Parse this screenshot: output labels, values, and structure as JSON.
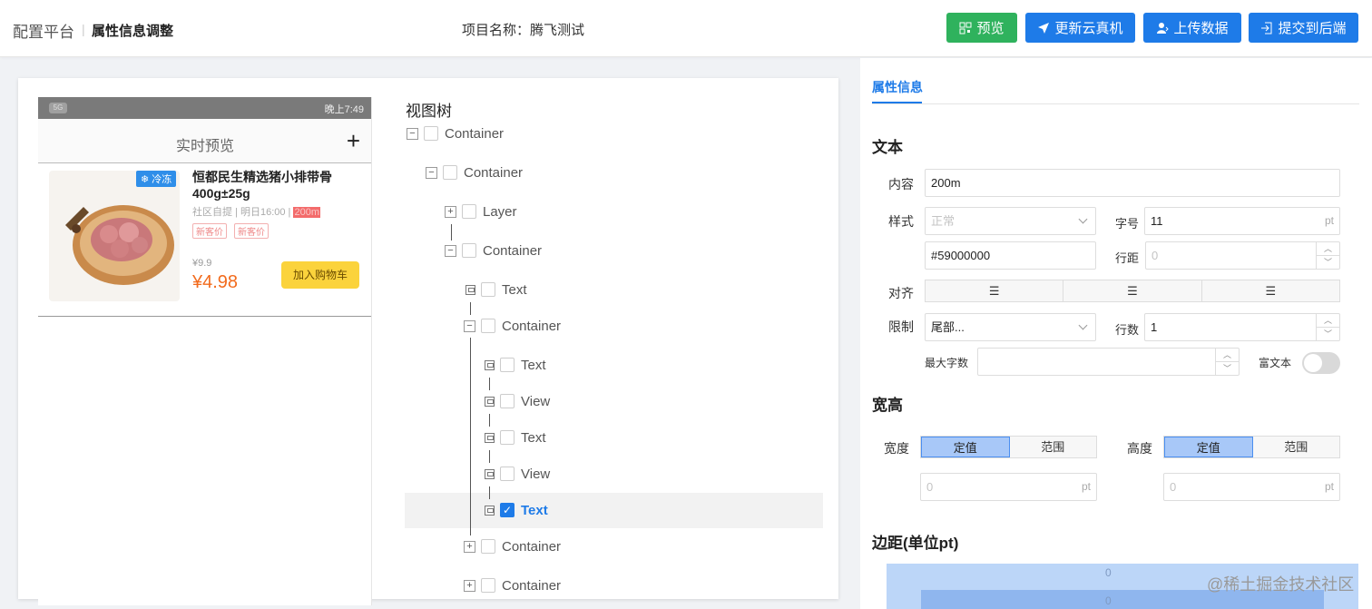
{
  "header": {
    "brand": "配置平台",
    "separator": "|",
    "page_title": "属性信息调整",
    "project_label": "项目名称：腾飞测试",
    "buttons": [
      {
        "label": "预览",
        "icon": "qrcode-icon"
      },
      {
        "label": "更新云真机",
        "icon": "send-icon"
      },
      {
        "label": "上传数据",
        "icon": "user-upload-icon"
      },
      {
        "label": "提交到后端",
        "icon": "login-icon"
      }
    ]
  },
  "phone": {
    "status_left": "5G",
    "status_right": "晚上7:49",
    "nav_title": "实时预览",
    "nav_add": "+",
    "goods": {
      "tag": "❄ 冷冻",
      "name": "恒都民生精选猪小排带骨400g±25g",
      "meta_pre": "社区自提 | 明日16:00 | ",
      "meta_hl": "200m",
      "badges": [
        "新客价",
        "新客价"
      ],
      "old_price": "¥9.9",
      "price": "¥4.98",
      "cart": "加入购物车"
    }
  },
  "tree": {
    "title": "视图树",
    "nodes": [
      "Container",
      "Container",
      "Layer",
      "Container",
      "Text",
      "Container",
      "Text",
      "View",
      "Text",
      "View",
      "Text",
      "Container",
      "Container"
    ]
  },
  "props": {
    "tab": "属性信息",
    "text_section": "文本",
    "content_label": "内容",
    "content_value": "200m",
    "style_label": "样式",
    "style_value": "正常",
    "fontsize_label": "字号",
    "fontsize_value": "11",
    "unit": "pt",
    "color_value": "#59000000",
    "lineheight_label": "行距",
    "lineheight_placeholder": "0",
    "align_label": "对齐",
    "limit_label": "限制",
    "limit_value": "尾部...",
    "lines_label": "行数",
    "lines_value": "1",
    "maxchars_label": "最大字数",
    "richtext_label": "富文本",
    "size_section": "宽高",
    "width_label": "宽度",
    "height_label": "高度",
    "fixed": "定值",
    "range": "范围",
    "width_placeholder": "0",
    "height_placeholder": "0",
    "margin_section": "边距(单位pt)",
    "margin_top": "0",
    "margin_inner": "0"
  },
  "watermark": "@稀土掘金技术社区"
}
